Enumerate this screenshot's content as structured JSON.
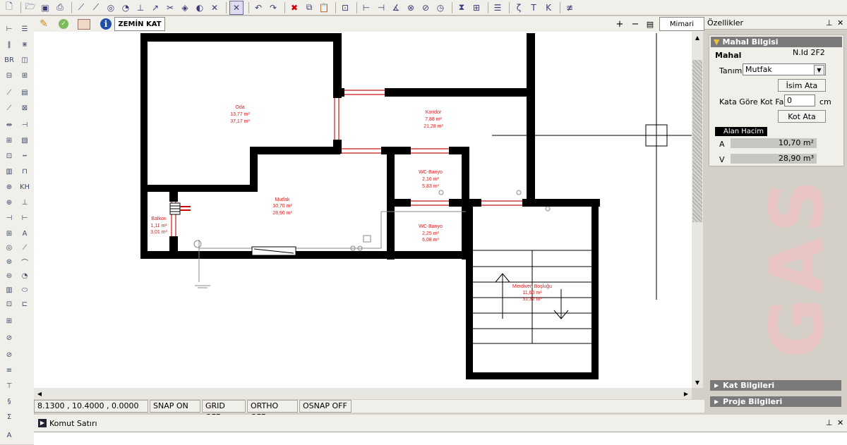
{
  "floor_tab": "ZEMİN KAT",
  "view_label": "Mimari",
  "zoom_plus": "+",
  "zoom_minus": "−",
  "rooms": [
    {
      "name": "Oda",
      "area": "13,77 m²",
      "volume": "37,17 m³"
    },
    {
      "name": "Koridor",
      "area": "7,88 m²",
      "volume": "21,28 m³"
    },
    {
      "name": "Mutfak",
      "area": "10,70 m²",
      "volume": "28,90 m³"
    },
    {
      "name": "WC-Banyo",
      "area": "2,16 m²",
      "volume": "5,83 m³"
    },
    {
      "name": "WC-Banyo",
      "area": "2,25 m²",
      "volume": "6,08 m³"
    },
    {
      "name": "Balkon",
      "area": "1,11 m²",
      "volume": "3,01 m³"
    },
    {
      "name": "Merdiven Boşluğu",
      "area": "11,60 m²",
      "volume": "31,32 m³"
    }
  ],
  "status": {
    "coords": "8.1300 , 10.4000 , 0.0000",
    "snap": "SNAP ON",
    "grid": "GRID OFF",
    "ortho": "ORTHO OFF",
    "osnap": "OSNAP OFF"
  },
  "command": {
    "title": "Komut Satırı",
    "pin": "⊥",
    "close": "✕"
  },
  "properties": {
    "title": "Özellikler",
    "pin": "⊥",
    "close": "✕",
    "section_mahal": "Mahal Bilgisi",
    "mahal_label": "Mahal",
    "nid": "N.Id 2F2",
    "tanim_label": "Tanım",
    "tanim_value": "Mutfak",
    "isim_button": "İsim Ata",
    "kot_label": "Kata Göre Kot Farkı",
    "kot_value": "0",
    "kot_unit": "cm",
    "kot_button": "Kot Ata",
    "alan_hacim": "Alan Hacim",
    "a_label": "A",
    "a_value": "10,70 m²",
    "v_label": "V",
    "v_value": "28,90 m³",
    "section_kat": "Kat Bilgileri",
    "section_proje": "Proje Bilgileri",
    "watermark": "GAS"
  },
  "colors": {
    "room_text": "#d42020",
    "wall": "#000000"
  }
}
